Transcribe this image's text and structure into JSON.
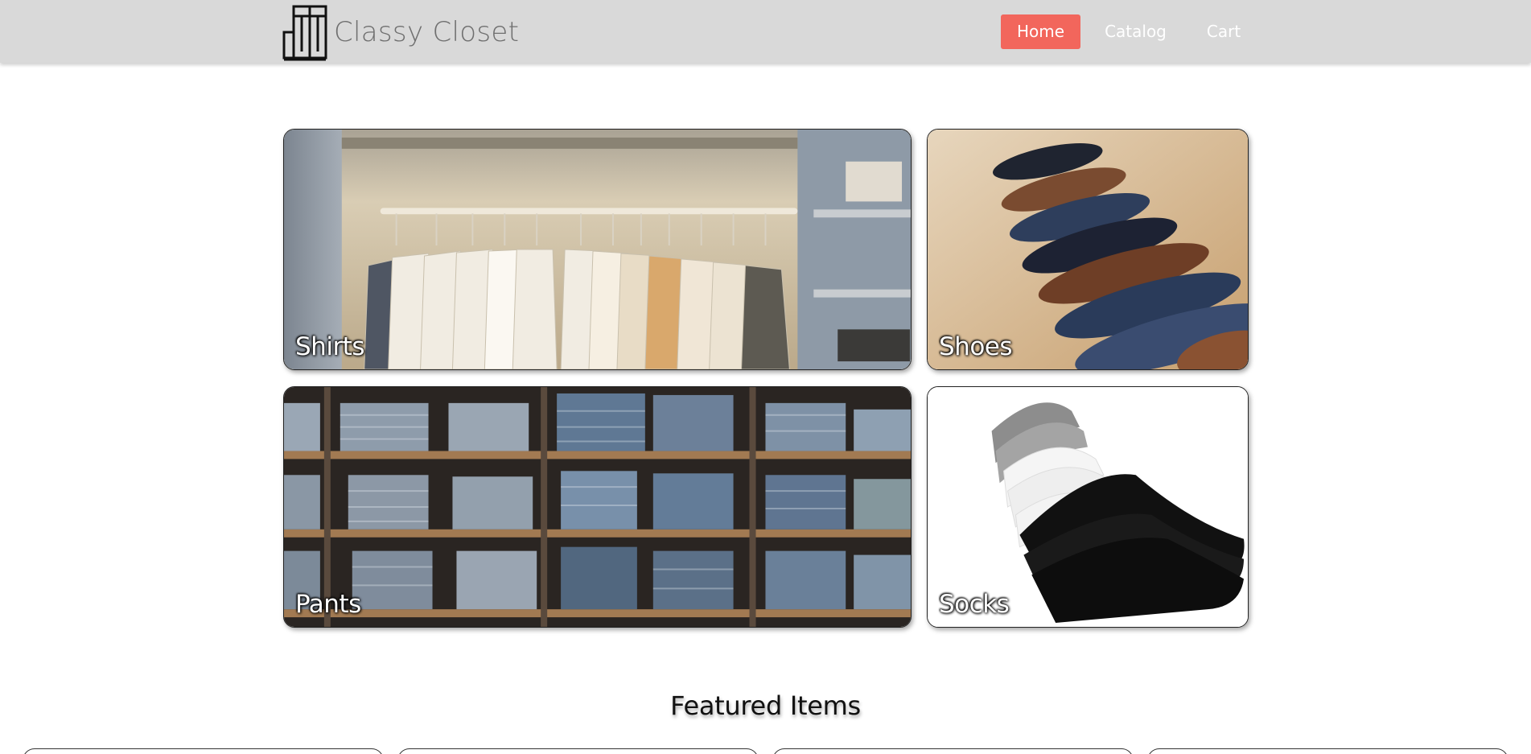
{
  "header": {
    "brand": "Classy Closet",
    "nav": [
      {
        "label": "Home",
        "active": true
      },
      {
        "label": "Catalog",
        "active": false
      },
      {
        "label": "Cart",
        "active": false
      }
    ]
  },
  "categories": [
    {
      "label": "Shirts",
      "image": "closet-hanging-shirts"
    },
    {
      "label": "Shoes",
      "image": "row-of-dress-shoes"
    },
    {
      "label": "Pants",
      "image": "stacked-jeans-shelves"
    },
    {
      "label": "Socks",
      "image": "stacked-ankle-socks"
    }
  ],
  "featured": {
    "title": "Featured Items"
  },
  "colors": {
    "header_bg": "#d9d9d9",
    "nav_active": "#f2665c",
    "brand_text": "#6f6f6f"
  }
}
